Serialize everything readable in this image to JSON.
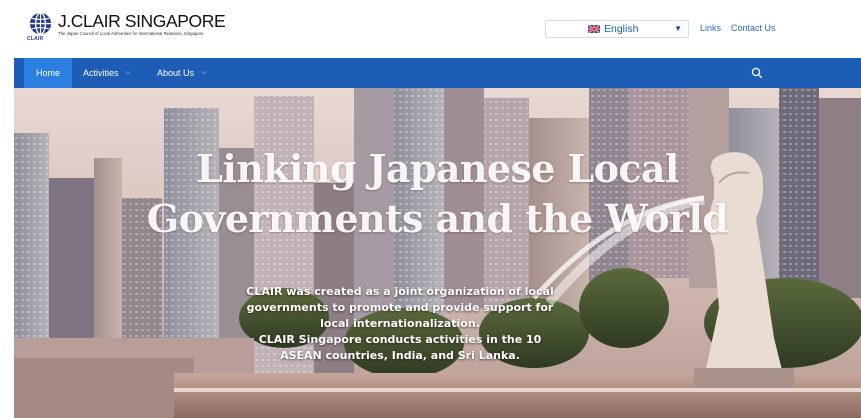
{
  "header": {
    "logo": {
      "title": "J.CLAIR SINGAPORE",
      "subtitle": "The Japan Council of Local Authorities for International Relations, Singapore",
      "mark_caption": "CLAIR",
      "icon": "globe-icon"
    },
    "language": {
      "selected": "English",
      "flag_icon": "uk-flag-icon",
      "caret_icon": "triangle-down-icon"
    },
    "links": [
      "Links",
      "Contact Us"
    ]
  },
  "nav": {
    "items": [
      {
        "label": "Home",
        "active": true
      },
      {
        "label": "Activities",
        "has_dropdown": true
      },
      {
        "label": "About Us",
        "has_dropdown": true
      }
    ],
    "search_icon": "search-icon"
  },
  "hero": {
    "title_lines": [
      "Linking Japanese Local",
      "Governments and the World"
    ],
    "description_lines": [
      "CLAIR was created as a joint organization of local",
      "governments to promote and provide support for",
      "local internationalization.",
      "CLAIR Singapore conducts activities in the 10",
      "ASEAN countries, India, and Sri Lanka."
    ]
  },
  "colors": {
    "nav_bg": "#1d5db6",
    "nav_active": "#2a7fe0",
    "link_blue": "#2c6cb8"
  }
}
